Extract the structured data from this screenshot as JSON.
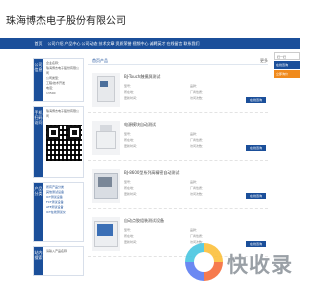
{
  "header": {
    "title": "珠海博杰电子股份有限公司"
  },
  "nav": {
    "items": [
      "首页",
      "公司介绍",
      "产品中心",
      "公司动态",
      "技术文章",
      "资质荣誉",
      "视频中心",
      "诚聘英才",
      "在线留言",
      "联系我们"
    ]
  },
  "sidebar": {
    "company": {
      "head": "公司信息",
      "lines": [
        "企业名称：",
        "珠海博杰电子股份有限公司",
        "公司类型：",
        "工程/技术开发",
        "电话：",
        "13500"
      ]
    },
    "contact": {
      "head": "手机扫码访问",
      "line": "珠海博杰电子股份有限公司"
    },
    "category": {
      "head": "产品分类",
      "items": [
        "所有产品分类",
        "其他测试设备",
        "ICT测试设备",
        "FCT测试设备",
        "ATE测试设备",
        "ICT在线测试仪"
      ]
    },
    "search": {
      "head": "站内搜索",
      "line": "请输入产品名称"
    }
  },
  "main": {
    "crumb": "首页产品",
    "more": "更多",
    "products": [
      {
        "name": "BJ-Touch触摸屏测试",
        "a1": "型号：",
        "a2": "所在地：",
        "a3": "更新时间：",
        "b1": "品牌：",
        "b2": "厂商性质：",
        "b3": "访问次数：",
        "detail": "在线咨询"
      },
      {
        "name": "电源模块自动测试",
        "a1": "型号：",
        "a2": "所在地：",
        "a3": "更新时间：",
        "b1": "品牌：",
        "b2": "厂商性质：",
        "b3": "访问次数：",
        "detail": "在线咨询"
      },
      {
        "name": "BJ-8600型系列高精密自动测试",
        "a1": "型号：",
        "a2": "所在地：",
        "a3": "更新时间：",
        "b1": "品牌：",
        "b2": "厂商性质：",
        "b3": "访问次数：",
        "detail": "在线咨询"
      },
      {
        "name": "自动点胶组装测试设备",
        "a1": "型号：",
        "a2": "所在地：",
        "a3": "更新时间：",
        "b1": "品牌：",
        "b2": "厂商性质：",
        "b3": "访问次数：",
        "detail": "在线咨询"
      }
    ]
  },
  "right_panel": {
    "head": "扫一扫",
    "btn1": "在线咨询",
    "btn2": "立即询价"
  },
  "watermark": {
    "text": "快收录"
  },
  "colors": {
    "brand_blue": "#1b4f9a",
    "accent_orange": "#f08a1c",
    "price_red": "#d23"
  }
}
